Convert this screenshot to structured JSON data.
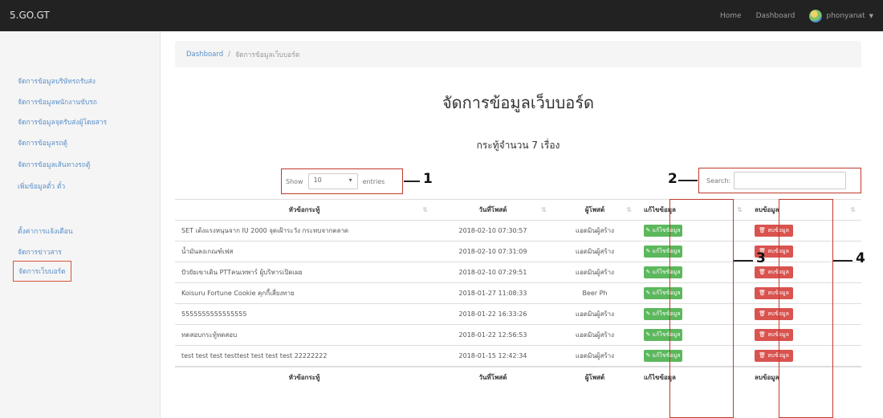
{
  "navbar": {
    "brand": "5.GO.GT",
    "links": [
      "Home",
      "Dashboard"
    ],
    "user": "phonyanat"
  },
  "sidebar": {
    "items": [
      "จัดการข้อมูลบริษัทรถรับส่ง",
      "จัดการข้อมูลพนักงานขับรถ",
      "จัดการข้อมูลจุดรับส่งผู้โดยสาร",
      "จัดการข้อมูลรถตู้",
      "จัดการข้อมูลเส้นทางรถตู้",
      "เพิ่มข้อมูลตั๋ว ตั๋ว",
      "ตั้งค่าการแจ้งเตือน",
      "จัดการข่าวสาร",
      "จัดการเว็บบอร์ด"
    ]
  },
  "breadcrumb": {
    "home": "Dashboard",
    "separator": "/",
    "current": "จัดการข้อมูลเว็บบอร์ด"
  },
  "page": {
    "title": "จัดการข้อมูลเว็บบอร์ด",
    "subtitle": "กระทู้จำนวน 7 เรื่อง"
  },
  "controls": {
    "show_label": "Show",
    "length_value": "10",
    "entries_label": "entries",
    "search_label": "Search:"
  },
  "callouts": [
    "1",
    "2",
    "3",
    "4"
  ],
  "table": {
    "headers": [
      "หัวข้อกระทู้",
      "วันที่โพสต์",
      "ผู้โพสต์",
      "แก้ไขข้อมูล",
      "ลบข้อมูล"
    ],
    "edit_label": "แก้ไขข้อมูล",
    "delete_label": "ลบข้อมูล",
    "rows": [
      [
        "SET เด้งแรงหนุนจาก IU 2000 จุดเฝ้าระวัง กระทบจากตลาด",
        "2018-02-10 07:30:57",
        "แอดมินผู้สร้าง"
      ],
      [
        "น้ำมันลงเกณฑ์เฟส",
        "2018-02-10 07:31:09",
        "แอดมินผู้สร้าง"
      ],
      [
        "ปัวยัยเขาเดิน PTTคนเทพาร์ ผู้บริหารเปิดเผย",
        "2018-02-10 07:29:51",
        "แอดมินผู้สร้าง"
      ],
      [
        "Koisuru Fortune Cookie คุกกี้เสี่ยงทาย",
        "2018-01-27 11:08:33",
        "Beer Ph"
      ],
      [
        "5555555555555555",
        "2018-01-22 16:33:26",
        "แอดมินผู้สร้าง"
      ],
      [
        "ทดสอบกระทู้ทดสอบ",
        "2018-01-22 12:56:53",
        "แอดมินผู้สร้าง"
      ],
      [
        "test test test testtest test test test 22222222",
        "2018-01-15 12:42:34",
        "แอดมินผู้สร้าง"
      ]
    ]
  }
}
